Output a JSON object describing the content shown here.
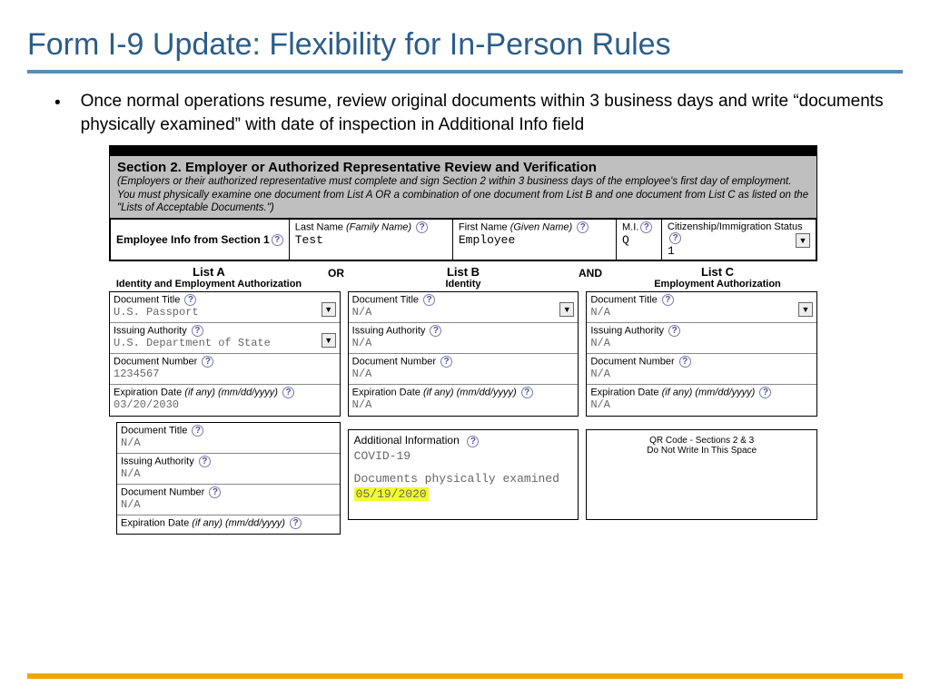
{
  "title": "Form I-9 Update: Flexibility for In-Person Rules",
  "bullet": "Once normal operations resume, review original documents within 3 business days and write “documents physically examined” with date of inspection in Additional Info field",
  "section": {
    "heading": "Section 2. Employer or Authorized Representative Review and Verification",
    "instructions": "(Employers or their authorized representative must complete and sign Section 2 within 3 business days of the employee's first day of employment. You must physically examine one document from List A OR a combination of one document from List B and one document from List C as listed on the \"Lists of Acceptable Documents.\")"
  },
  "employee_row": {
    "lead": "Employee Info from Section 1",
    "last_label": "Last Name",
    "last_hint": "(Family Name)",
    "last_val": "Test",
    "first_label": "First Name",
    "first_hint": "(Given Name)",
    "first_val": "Employee",
    "mi_label": "M.I.",
    "mi_val": "Q",
    "cit_label": "Citizenship/Immigration Status",
    "cit_val": "1"
  },
  "list_heads": {
    "a_big": "List A",
    "a_sub": "Identity and Employment Authorization",
    "or": "OR",
    "b_big": "List B",
    "b_sub": "Identity",
    "and": "AND",
    "c_big": "List C",
    "c_sub": "Employment Authorization"
  },
  "labels": {
    "doc_title": "Document Title",
    "issuing_auth": "Issuing Authority",
    "doc_number": "Document Number",
    "exp_date": "Expiration Date",
    "exp_hint": "(if any) (mm/dd/yyyy)",
    "addl_info": "Additional Information",
    "qr1": "QR Code - Sections 2 & 3",
    "qr2": "Do Not Write In This Space"
  },
  "listA1": {
    "doc_title": "U.S. Passport",
    "issuing_auth": "U.S. Department of State",
    "doc_number": "1234567",
    "exp_date": "03/20/2030"
  },
  "listA2": {
    "doc_title": "N/A",
    "issuing_auth": "N/A",
    "doc_number": "N/A",
    "exp_date": ""
  },
  "listB": {
    "doc_title": "N/A",
    "issuing_auth": "N/A",
    "doc_number": "N/A",
    "exp_date": "N/A"
  },
  "listC": {
    "doc_title": "N/A",
    "issuing_auth": "N/A",
    "doc_number": "N/A",
    "exp_date": "N/A"
  },
  "additional": {
    "line1": "COVID-19",
    "line2": "Documents physically examined",
    "date": "05/19/2020"
  }
}
